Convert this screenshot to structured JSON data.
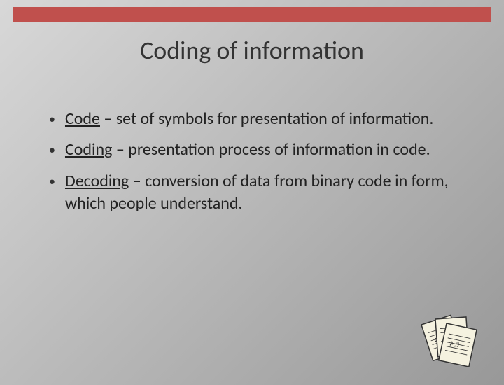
{
  "title": "Coding of information",
  "bullets": [
    {
      "term": "Code",
      "rest": " – set of symbols for presentation of information."
    },
    {
      "term": "Coding",
      "rest": " – presentation process of information in code."
    },
    {
      "term": "Decoding",
      "rest": " – conversion of data from binary code in form, which people understand."
    }
  ]
}
